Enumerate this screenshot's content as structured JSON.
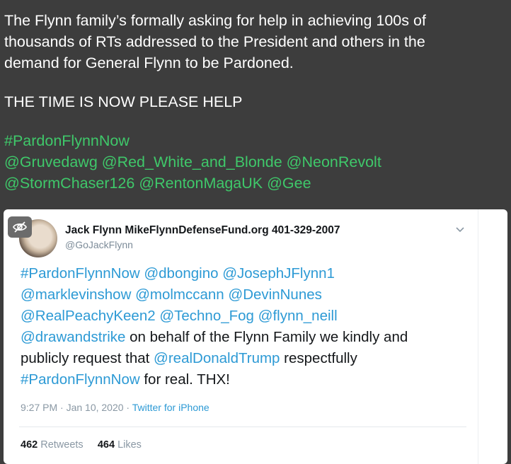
{
  "post": {
    "line1": "The Flynn family’s formally asking for help in achieving 100s of",
    "line2": "thousands of RTs addressed to the President and others in the",
    "line3": "demand for General Flynn to be Pardoned.",
    "line4": "THE TIME IS NOW PLEASE HELP",
    "hashtag": "#PardonFlynnNow",
    "mentions1": "@Gruvedawg @Red_White_and_Blonde @NeonRevolt",
    "mentions2": "@StormChaser126 @RentonMagaUK @Gee",
    "text_color": "#ffffff",
    "tag_color": "#3fc86a",
    "background": "#3d3d3d"
  },
  "screenshot": {
    "author_name": "Jack Flynn MikeFlynnDefenseFund.org 401-329-2007",
    "author_handle": "@GoJackFlynn",
    "tweet": {
      "l1": "#PardonFlynnNow @dbongino @JosephJFlynn1",
      "l2": "@marklevinshow @molmccann @DevinNunes",
      "l3": "@RealPeachyKeen2 @Techno_Fog @flynn_neill",
      "l4_mention": "@drawandstrike",
      "l4_rest": " on behalf of the Flynn Family we kindly and",
      "l5_start": "publicly request that ",
      "l5_mention": "@realDonaldTrump",
      "l5_rest": " respectfully",
      "l6_tag": "#PardonFlynnNow",
      "l6_rest": " for real. THX!"
    },
    "time": "9:27 PM · Jan 10, 2020 · ",
    "source": "Twitter for iPhone",
    "retweets_count": "462",
    "retweets_label": "Retweets",
    "likes_count": "464",
    "likes_label": "Likes",
    "link_color": "#2d9ad5"
  },
  "icons": {
    "hide": "eye-slash-icon",
    "menu": "chevron-down-icon"
  }
}
